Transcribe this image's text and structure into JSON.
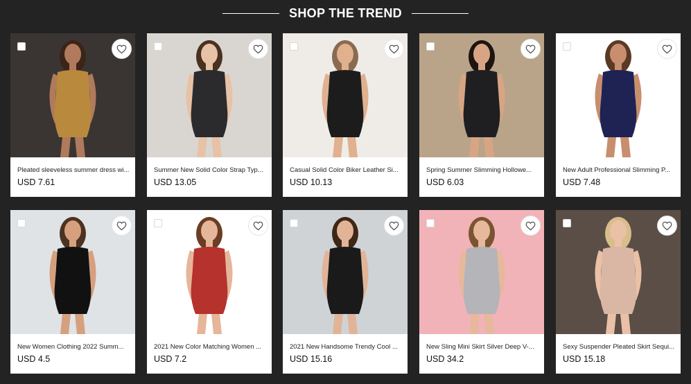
{
  "section": {
    "title": "SHOP THE TREND"
  },
  "products": [
    {
      "name": "Pleated sleeveless summer dress wi...",
      "price": "USD 7.61",
      "bg": "#3a3533",
      "dress": "#b98a3e",
      "skin": "#b07a5c",
      "hair": "#3b2418"
    },
    {
      "name": "Summer New Solid Color Strap Typ...",
      "price": "USD 13.05",
      "bg": "#d9d6d2",
      "dress": "#2b2b2e",
      "skin": "#e8c2a6",
      "hair": "#4a3020"
    },
    {
      "name": "Casual Solid Color Biker Leather Si...",
      "price": "USD 10.13",
      "bg": "#efece8",
      "dress": "#1c1c1c",
      "skin": "#e0b08f",
      "hair": "#8a6b4f"
    },
    {
      "name": "Spring Summer Slimming Hollowe...",
      "price": "USD 6.03",
      "bg": "#b9a48a",
      "dress": "#1f1f22",
      "skin": "#d8a584",
      "hair": "#1e1410"
    },
    {
      "name": "New Adult Professional Slimming P...",
      "price": "USD 7.48",
      "bg": "#ffffff",
      "dress": "#1f2354",
      "skin": "#c98e6e",
      "hair": "#5a3a25"
    },
    {
      "name": "New Women Clothing 2022 Summ...",
      "price": "USD 4.5",
      "bg": "#dfe3e6",
      "dress": "#111111",
      "skin": "#d6a07e",
      "hair": "#4b3222"
    },
    {
      "name": "2021 New Color Matching Women ...",
      "price": "USD 7.2",
      "bg": "#ffffff",
      "dress": "#b5322d",
      "skin": "#e6b69a",
      "hair": "#6b3d22"
    },
    {
      "name": "2021 New Handsome Trendy Cool ...",
      "price": "USD 15.16",
      "bg": "#cfd3d6",
      "dress": "#1a1a1a",
      "skin": "#e2b497",
      "hair": "#3e2717"
    },
    {
      "name": "New Sling Mini Skirt Silver Deep V-...",
      "price": "USD 34.2",
      "bg": "#f2b3b8",
      "dress": "#b5b4b8",
      "skin": "#e6b89c",
      "hair": "#7a5330"
    },
    {
      "name": "Sexy Suspender Pleated Skirt Sequi...",
      "price": "USD 15.18",
      "bg": "#5a4e46",
      "dress": "#d9b7a4",
      "skin": "#eac1a6",
      "hair": "#d9bd8a"
    }
  ]
}
